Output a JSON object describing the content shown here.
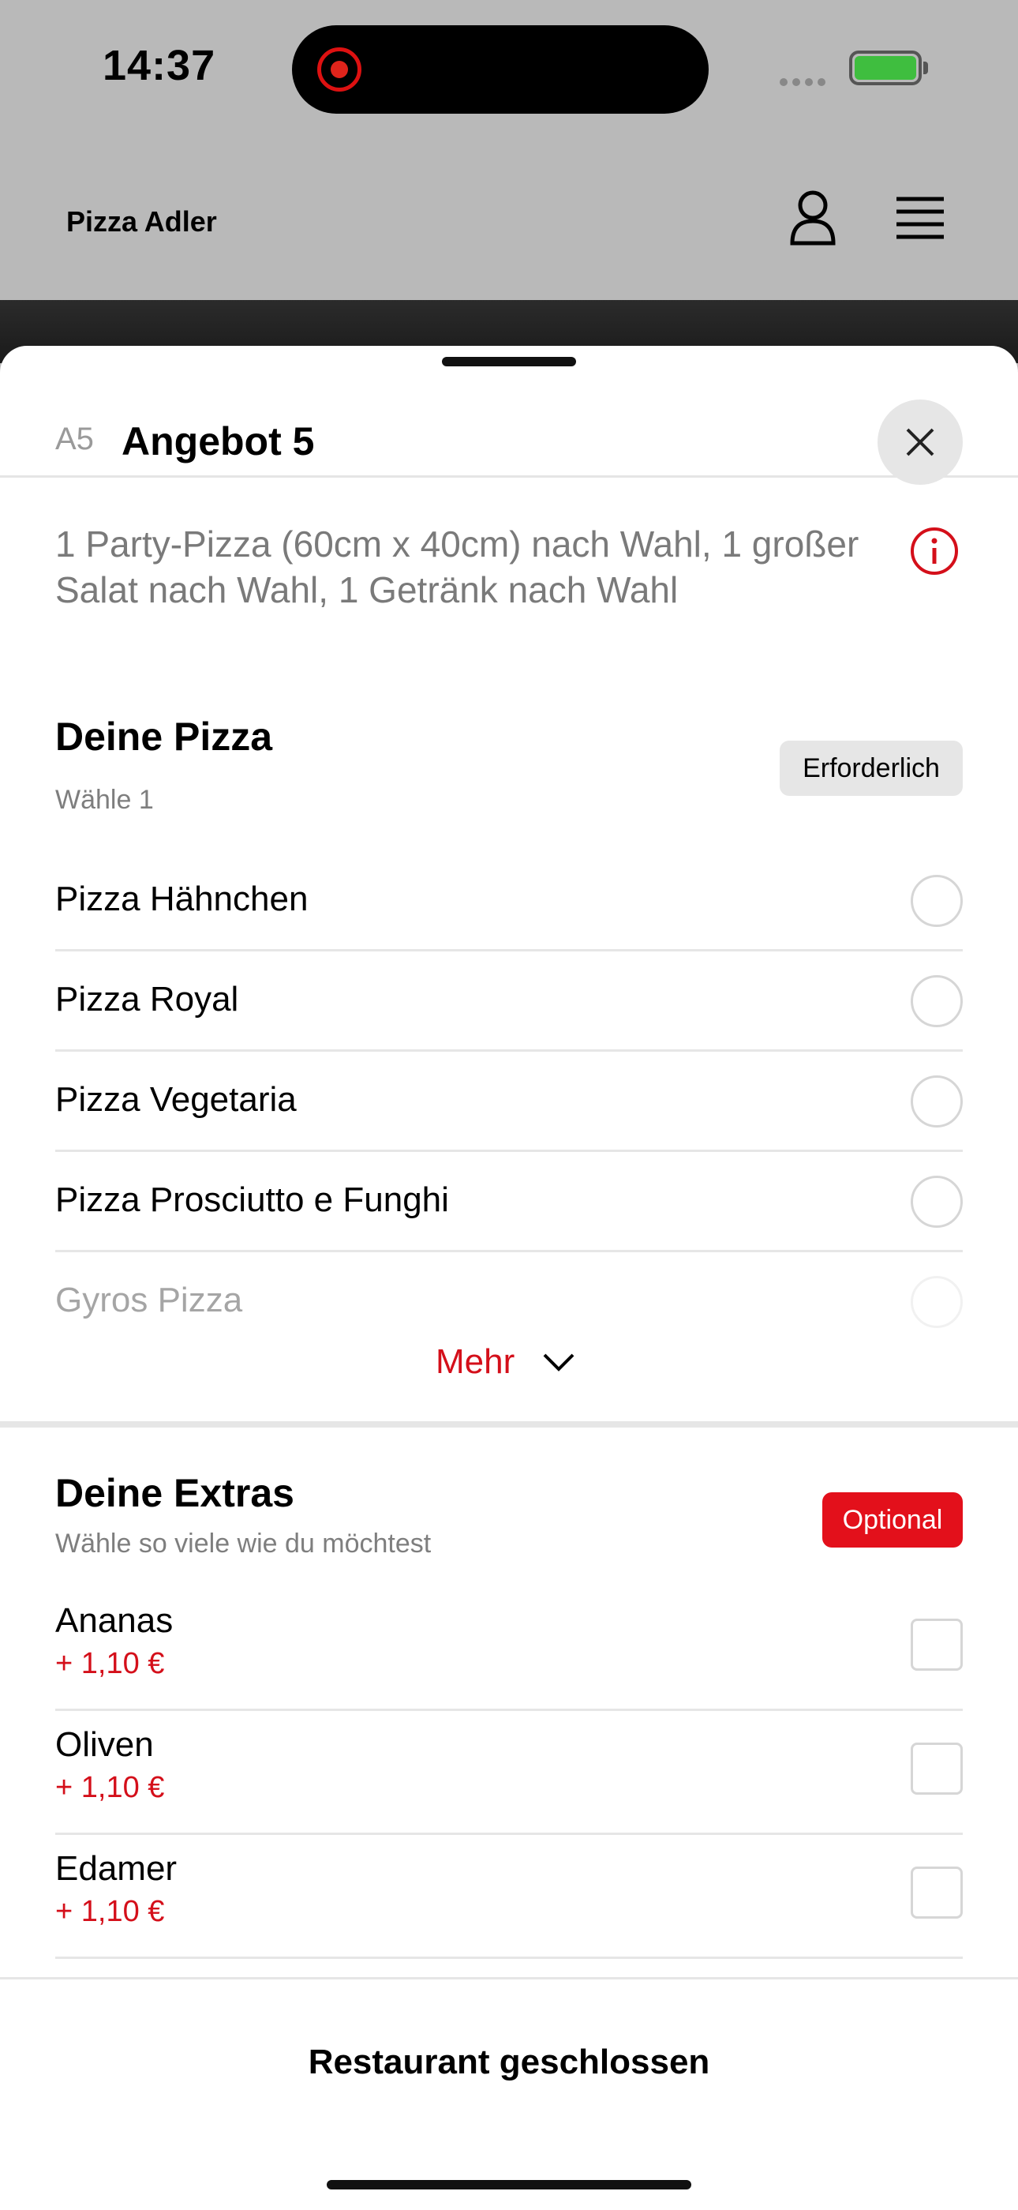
{
  "status_bar": {
    "time": "14:37"
  },
  "header": {
    "brand": "Pizza Adler"
  },
  "sheet": {
    "code": "A5",
    "title": "Angebot 5",
    "description": "1 Party-Pizza (60cm x 40cm) nach Wahl, 1 großer Salat nach Wahl, 1 Getränk nach Wahl"
  },
  "pizza_section": {
    "title": "Deine Pizza",
    "subtitle": "Wähle 1",
    "badge": "Erforderlich",
    "options": [
      {
        "label": "Pizza Hähnchen"
      },
      {
        "label": "Pizza Royal"
      },
      {
        "label": "Pizza Vegetaria"
      },
      {
        "label": "Pizza Prosciutto e Funghi"
      },
      {
        "label": "Gyros Pizza"
      }
    ],
    "more_label": "Mehr"
  },
  "extras_section": {
    "title": "Deine Extras",
    "subtitle": "Wähle so viele wie du möchtest",
    "badge": "Optional",
    "items": [
      {
        "label": "Ananas",
        "price": "+ 1,10 €"
      },
      {
        "label": "Oliven",
        "price": "+ 1,10 €"
      },
      {
        "label": "Edamer",
        "price": "+ 1,10 €"
      }
    ]
  },
  "footer": {
    "status": "Restaurant geschlossen"
  },
  "colors": {
    "accent": "#e3101b",
    "muted_text": "#7a7a7a",
    "header_bg": "#b9b9b9"
  }
}
